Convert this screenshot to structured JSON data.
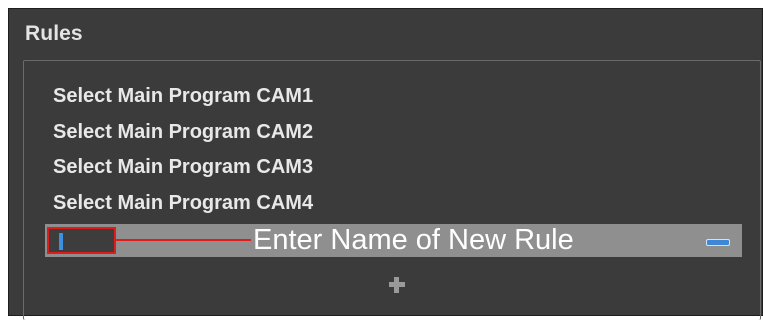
{
  "section": {
    "title": "Rules"
  },
  "rules": {
    "items": [
      {
        "label": "Select Main Program CAM1"
      },
      {
        "label": "Select Main Program CAM2"
      },
      {
        "label": "Select Main Program CAM3"
      },
      {
        "label": "Select Main Program CAM4"
      }
    ],
    "new_rule": {
      "value": "",
      "callout": "Enter Name of New Rule"
    }
  },
  "icons": {
    "remove": "minus-icon",
    "add": "plus-icon"
  },
  "colors": {
    "panel_background": "#3b3b3b",
    "selected_row": "#8f8f8f",
    "callout_highlight": "#e01b1b",
    "accent_blue": "#3e86d8"
  }
}
